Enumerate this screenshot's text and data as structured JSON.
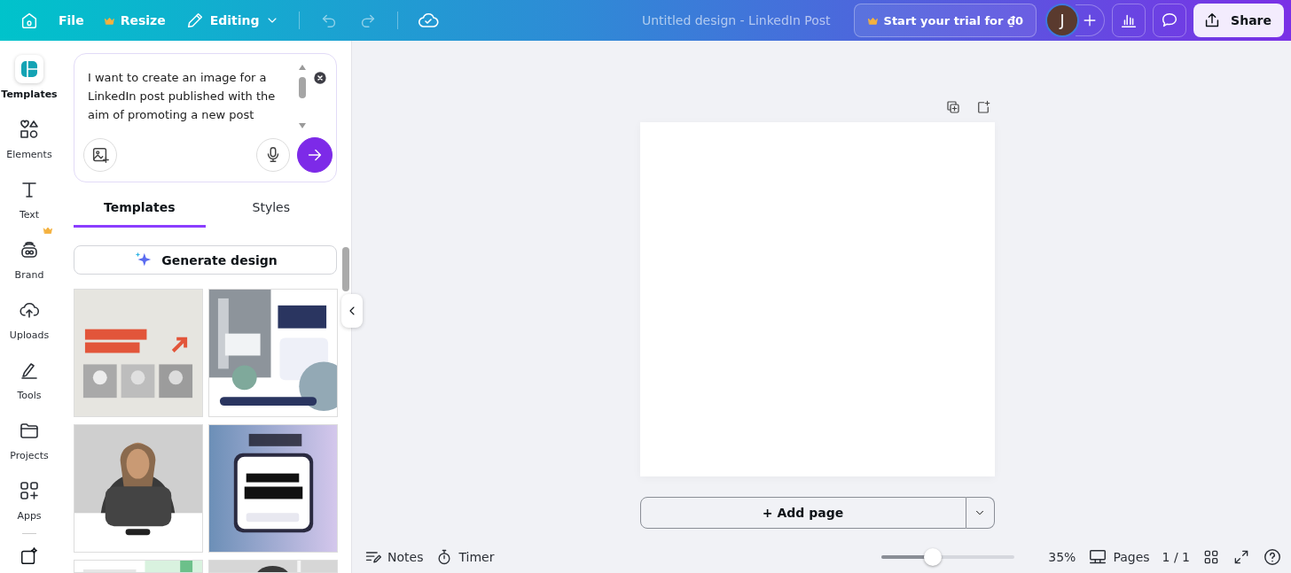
{
  "topbar": {
    "menu": [
      {
        "kind": "home"
      },
      {
        "kind": "text",
        "label": "File"
      },
      {
        "kind": "premium",
        "label": "Resize"
      },
      {
        "kind": "mode",
        "label": "Editing"
      }
    ],
    "title": "Untitled design - LinkedIn Post",
    "trial": "Start your trial for ₫0",
    "avatar": "J",
    "share": "Share"
  },
  "rail": [
    {
      "label": "Templates",
      "kind": "templates",
      "selected": true,
      "premium": false
    },
    {
      "label": "Elements",
      "kind": "elements",
      "selected": false,
      "premium": false
    },
    {
      "label": "Text",
      "kind": "text",
      "selected": false,
      "premium": false
    },
    {
      "label": "Brand",
      "kind": "brand",
      "selected": false,
      "premium": true
    },
    {
      "label": "Uploads",
      "kind": "uploads",
      "selected": false,
      "premium": false
    },
    {
      "label": "Tools",
      "kind": "tools",
      "selected": false,
      "premium": false
    },
    {
      "label": "Projects",
      "kind": "projects",
      "selected": false,
      "premium": false
    },
    {
      "label": "Apps",
      "kind": "apps",
      "selected": false,
      "premium": false
    }
  ],
  "prompt": {
    "value": "I want to create an image for a LinkedIn post published with the aim of promoting a new post"
  },
  "tabs": [
    {
      "label": "Templates",
      "selected": true
    },
    {
      "label": "Styles",
      "selected": false
    }
  ],
  "generate": "Generate design",
  "add_page": "+ Add page",
  "footer": {
    "notes": "Notes",
    "timer": "Timer",
    "zoom": {
      "level": 0.34
    },
    "zoom_reading": "35%",
    "pages": "Pages",
    "page_count": "1 / 1"
  }
}
